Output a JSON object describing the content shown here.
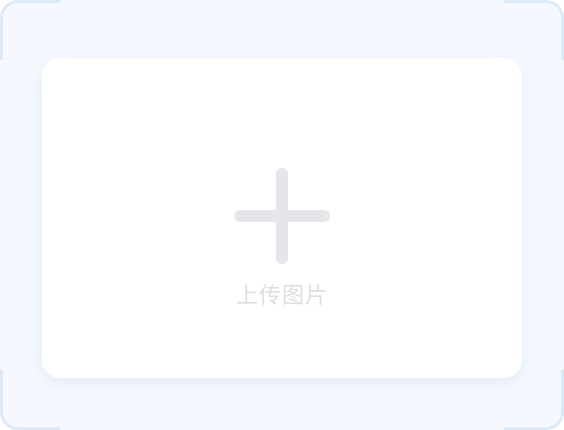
{
  "upload": {
    "label": "上传图片",
    "icon": "plus-icon"
  },
  "colors": {
    "frame_background": "#f5f9ff",
    "corner_accent": "#dce9f8",
    "card_background": "#ffffff",
    "icon": "#e4e6ea",
    "label_text": "#dcdee2"
  }
}
